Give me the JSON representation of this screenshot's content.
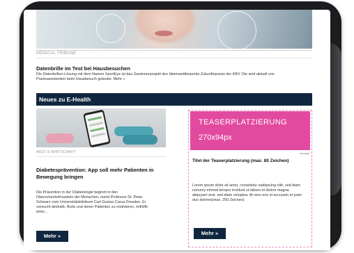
{
  "hero": {
    "source": "MEDICAL TRIBUNE"
  },
  "article": {
    "title": "Datenbrille im Test bei Hausbesuchen",
    "text": "Die Datenbrillen-Lösung mit dem Namen XpertEye ist das Gewinnerprojekt des Ideenwettbewerbs Zukunftspraxis der KBV. Die wird aktuell von Praxisassistenten beim Hausbesuch getestet. Mehr »"
  },
  "section": {
    "title": "Neues zu E-Health"
  },
  "card_left": {
    "source": "ARZT & WIRTSCHAFT",
    "title": "Diabetesprävention: App soll mehr Patienten in Bewegung bringen",
    "text": "Die Prävention in der Diabetologie beginnt in den Oberschenkelmuskeln der Menschen, meint Professor Dr. Peter Schwarz vom Universitätsklinikum Carl Gustav Carus Dresden. Er versucht deshalb, Ärzte und deren Patienten zu motivieren, mithilfe einer...",
    "button": "Mehr »"
  },
  "teaser": {
    "ad_line1": "TEASERPLATZIERUNG",
    "ad_line2": "270x94px",
    "ad_label": "Anzeige",
    "title": "Titel der Teaserplatzierung (max. 80 Zeichen)",
    "text": "Lorem ipsum dolor sit amet, consetetur sadipscing elitr, sed diam nonumy eirmod tempor invidunt ut labore et dolore magna aliquyam erat, sed diam voluptua. At vero eos et accusam et justo duo dolores(max. 250 Zeichen)",
    "button": "Mehr »"
  },
  "colors": {
    "navy": "#10263f",
    "pink": "#e24a9f"
  }
}
